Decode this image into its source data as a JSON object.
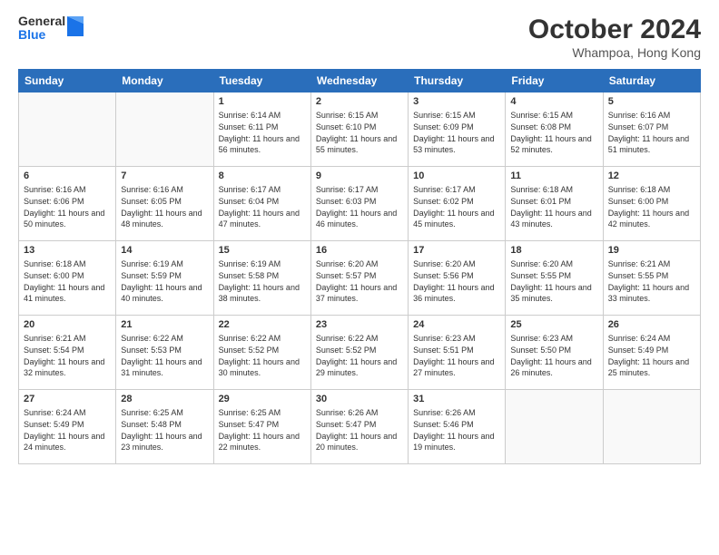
{
  "header": {
    "logo_general": "General",
    "logo_blue": "Blue",
    "month_title": "October 2024",
    "location": "Whampoa, Hong Kong"
  },
  "days_of_week": [
    "Sunday",
    "Monday",
    "Tuesday",
    "Wednesday",
    "Thursday",
    "Friday",
    "Saturday"
  ],
  "weeks": [
    [
      {
        "day": "",
        "content": ""
      },
      {
        "day": "",
        "content": ""
      },
      {
        "day": "1",
        "content": "Sunrise: 6:14 AM\nSunset: 6:11 PM\nDaylight: 11 hours and 56 minutes."
      },
      {
        "day": "2",
        "content": "Sunrise: 6:15 AM\nSunset: 6:10 PM\nDaylight: 11 hours and 55 minutes."
      },
      {
        "day": "3",
        "content": "Sunrise: 6:15 AM\nSunset: 6:09 PM\nDaylight: 11 hours and 53 minutes."
      },
      {
        "day": "4",
        "content": "Sunrise: 6:15 AM\nSunset: 6:08 PM\nDaylight: 11 hours and 52 minutes."
      },
      {
        "day": "5",
        "content": "Sunrise: 6:16 AM\nSunset: 6:07 PM\nDaylight: 11 hours and 51 minutes."
      }
    ],
    [
      {
        "day": "6",
        "content": "Sunrise: 6:16 AM\nSunset: 6:06 PM\nDaylight: 11 hours and 50 minutes."
      },
      {
        "day": "7",
        "content": "Sunrise: 6:16 AM\nSunset: 6:05 PM\nDaylight: 11 hours and 48 minutes."
      },
      {
        "day": "8",
        "content": "Sunrise: 6:17 AM\nSunset: 6:04 PM\nDaylight: 11 hours and 47 minutes."
      },
      {
        "day": "9",
        "content": "Sunrise: 6:17 AM\nSunset: 6:03 PM\nDaylight: 11 hours and 46 minutes."
      },
      {
        "day": "10",
        "content": "Sunrise: 6:17 AM\nSunset: 6:02 PM\nDaylight: 11 hours and 45 minutes."
      },
      {
        "day": "11",
        "content": "Sunrise: 6:18 AM\nSunset: 6:01 PM\nDaylight: 11 hours and 43 minutes."
      },
      {
        "day": "12",
        "content": "Sunrise: 6:18 AM\nSunset: 6:00 PM\nDaylight: 11 hours and 42 minutes."
      }
    ],
    [
      {
        "day": "13",
        "content": "Sunrise: 6:18 AM\nSunset: 6:00 PM\nDaylight: 11 hours and 41 minutes."
      },
      {
        "day": "14",
        "content": "Sunrise: 6:19 AM\nSunset: 5:59 PM\nDaylight: 11 hours and 40 minutes."
      },
      {
        "day": "15",
        "content": "Sunrise: 6:19 AM\nSunset: 5:58 PM\nDaylight: 11 hours and 38 minutes."
      },
      {
        "day": "16",
        "content": "Sunrise: 6:20 AM\nSunset: 5:57 PM\nDaylight: 11 hours and 37 minutes."
      },
      {
        "day": "17",
        "content": "Sunrise: 6:20 AM\nSunset: 5:56 PM\nDaylight: 11 hours and 36 minutes."
      },
      {
        "day": "18",
        "content": "Sunrise: 6:20 AM\nSunset: 5:55 PM\nDaylight: 11 hours and 35 minutes."
      },
      {
        "day": "19",
        "content": "Sunrise: 6:21 AM\nSunset: 5:55 PM\nDaylight: 11 hours and 33 minutes."
      }
    ],
    [
      {
        "day": "20",
        "content": "Sunrise: 6:21 AM\nSunset: 5:54 PM\nDaylight: 11 hours and 32 minutes."
      },
      {
        "day": "21",
        "content": "Sunrise: 6:22 AM\nSunset: 5:53 PM\nDaylight: 11 hours and 31 minutes."
      },
      {
        "day": "22",
        "content": "Sunrise: 6:22 AM\nSunset: 5:52 PM\nDaylight: 11 hours and 30 minutes."
      },
      {
        "day": "23",
        "content": "Sunrise: 6:22 AM\nSunset: 5:52 PM\nDaylight: 11 hours and 29 minutes."
      },
      {
        "day": "24",
        "content": "Sunrise: 6:23 AM\nSunset: 5:51 PM\nDaylight: 11 hours and 27 minutes."
      },
      {
        "day": "25",
        "content": "Sunrise: 6:23 AM\nSunset: 5:50 PM\nDaylight: 11 hours and 26 minutes."
      },
      {
        "day": "26",
        "content": "Sunrise: 6:24 AM\nSunset: 5:49 PM\nDaylight: 11 hours and 25 minutes."
      }
    ],
    [
      {
        "day": "27",
        "content": "Sunrise: 6:24 AM\nSunset: 5:49 PM\nDaylight: 11 hours and 24 minutes."
      },
      {
        "day": "28",
        "content": "Sunrise: 6:25 AM\nSunset: 5:48 PM\nDaylight: 11 hours and 23 minutes."
      },
      {
        "day": "29",
        "content": "Sunrise: 6:25 AM\nSunset: 5:47 PM\nDaylight: 11 hours and 22 minutes."
      },
      {
        "day": "30",
        "content": "Sunrise: 6:26 AM\nSunset: 5:47 PM\nDaylight: 11 hours and 20 minutes."
      },
      {
        "day": "31",
        "content": "Sunrise: 6:26 AM\nSunset: 5:46 PM\nDaylight: 11 hours and 19 minutes."
      },
      {
        "day": "",
        "content": ""
      },
      {
        "day": "",
        "content": ""
      }
    ]
  ]
}
